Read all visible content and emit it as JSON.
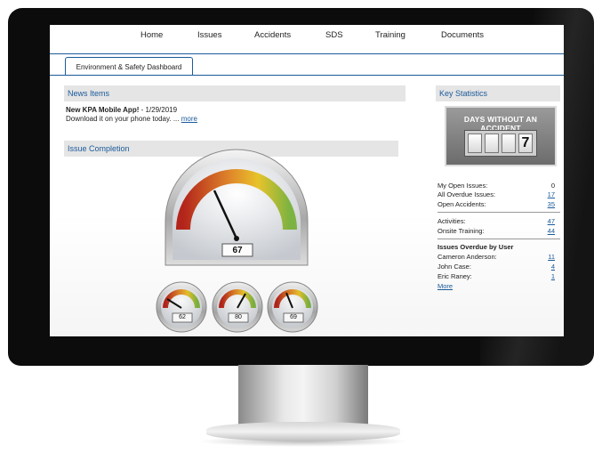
{
  "nav": {
    "items": [
      "Home",
      "Issues",
      "Accidents",
      "SDS",
      "Training",
      "Documents"
    ]
  },
  "tab": {
    "label": "Environment & Safety Dashboard"
  },
  "news": {
    "heading": "News Items",
    "item_title": "New KPA Mobile App!",
    "item_date": " - 1/29/2019",
    "item_body": "Download it on your phone today. ...",
    "more_label": "more"
  },
  "issue_completion": {
    "heading": "Issue Completion",
    "main_gauge_value": "67",
    "small_gauges": [
      "62",
      "80",
      "69"
    ]
  },
  "key_stats": {
    "heading": "Key Statistics",
    "days_label": "DAYS WITHOUT AN ACCIDENT",
    "days_value": "7",
    "rows": [
      {
        "label": "My Open Issues:",
        "value": "0"
      },
      {
        "label": "All Overdue Issues:",
        "value": "17"
      },
      {
        "label": "Open Accidents:",
        "value": "35"
      },
      {
        "label": "Activities:",
        "value": "47"
      },
      {
        "label": "Onsite Training:",
        "value": "44"
      }
    ],
    "overdue_heading": "Issues Overdue by User",
    "overdue_users": [
      {
        "name": "Cameron Anderson:",
        "value": "11"
      },
      {
        "name": "John Case:",
        "value": "4"
      },
      {
        "name": "Eric Raney:",
        "value": "1"
      }
    ],
    "more_label": "More"
  },
  "colors": {
    "accent": "#1a5a9a",
    "gauge_red": "#c0392b",
    "gauge_yellow": "#e8c32a",
    "gauge_green": "#7cb342"
  }
}
